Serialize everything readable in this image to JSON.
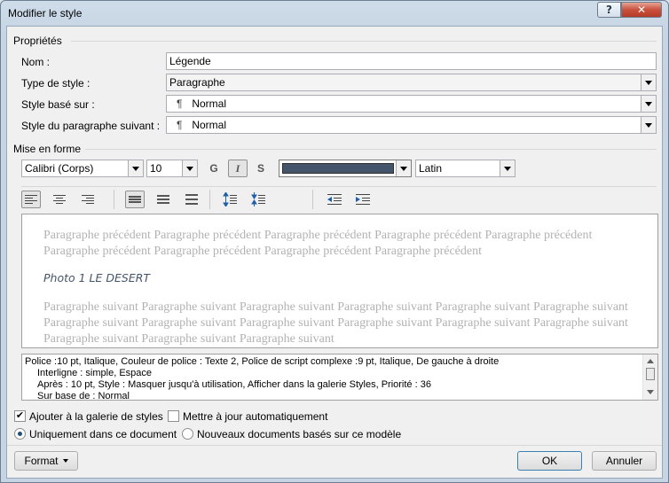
{
  "window": {
    "title": "Modifier le style",
    "help_label": "?",
    "close_label": "✕"
  },
  "properties": {
    "group_label": "Propriétés",
    "name_label": "Nom :",
    "name_value": "Légende",
    "type_label": "Type de style :",
    "type_value": "Paragraphe",
    "based_on_label": "Style basé sur :",
    "based_on_value": "Normal",
    "next_label": "Style du paragraphe suivant :",
    "next_value": "Normal",
    "pilcrow": "¶"
  },
  "formatting": {
    "group_label": "Mise en forme",
    "font": "Calibri (Corps)",
    "size": "10",
    "bold_label": "G",
    "italic_label": "I",
    "underline_label": "S",
    "font_color": "#44546a",
    "language": "Latin"
  },
  "paragraph_buttons": [
    "align-left-icon",
    "align-center-icon",
    "align-right-icon",
    "single-spacing-icon",
    "one-half-spacing-icon",
    "double-spacing-icon",
    "increase-paragraph-spacing-icon",
    "decrease-paragraph-spacing-icon",
    "decrease-indent-icon",
    "increase-indent-icon"
  ],
  "preview": {
    "previous": "Paragraphe précédent Paragraphe précédent Paragraphe précédent Paragraphe précédent Paragraphe précédent Paragraphe précédent Paragraphe précédent Paragraphe précédent Paragraphe précédent",
    "sample": "Photo 1 LE DESERT",
    "next": "Paragraphe suivant Paragraphe suivant Paragraphe suivant Paragraphe suivant Paragraphe suivant Paragraphe suivant Paragraphe suivant Paragraphe suivant Paragraphe suivant Paragraphe suivant Paragraphe suivant Paragraphe suivant Paragraphe suivant Paragraphe suivant Paragraphe suivant"
  },
  "description": {
    "line1": "Police :10 pt, Italique, Couleur de police : Texte 2, Police de script complexe :9 pt, Italique, De gauche à droite",
    "line2": "Interligne : simple, Espace",
    "line3": "Après : 10 pt, Style : Masquer jusqu'à utilisation, Afficher dans la galerie Styles, Priorité : 36",
    "line4": "Sur base de : Normal"
  },
  "options": {
    "add_to_gallery": "Ajouter à la galerie de styles",
    "add_to_gallery_checked": true,
    "auto_update": "Mettre à jour automatiquement",
    "auto_update_checked": false,
    "only_this_doc": "Uniquement dans ce document",
    "new_docs": "Nouveaux documents basés sur ce modèle",
    "selected_scope": "only_this_doc"
  },
  "buttons": {
    "format": "Format",
    "ok": "OK",
    "cancel": "Annuler"
  }
}
